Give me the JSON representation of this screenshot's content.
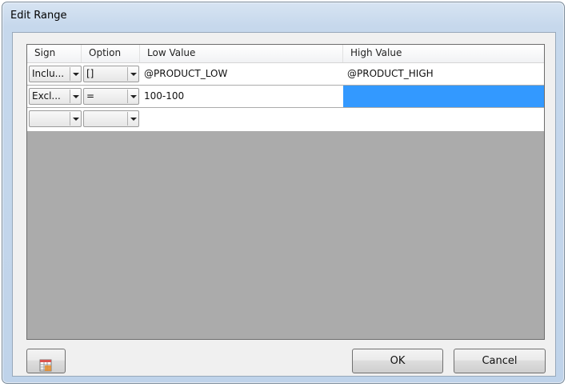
{
  "window": {
    "title": "Edit Range"
  },
  "grid": {
    "columns": [
      "Sign",
      "Option",
      "Low Value",
      "High Value"
    ],
    "rows": [
      {
        "sign": "Inclu...",
        "option": "[]",
        "low": "@PRODUCT_LOW",
        "high": "@PRODUCT_HIGH"
      },
      {
        "sign": "Excl...",
        "option": "=",
        "low": "100-100",
        "high": ""
      },
      {
        "sign": "",
        "option": "",
        "low": "",
        "high": ""
      }
    ]
  },
  "buttons": {
    "ok": "OK",
    "cancel": "Cancel"
  },
  "icons": {
    "bottom_left": "spreadsheet-icon"
  },
  "colors": {
    "selection": "#3399ff",
    "grid_background": "#ababab"
  }
}
